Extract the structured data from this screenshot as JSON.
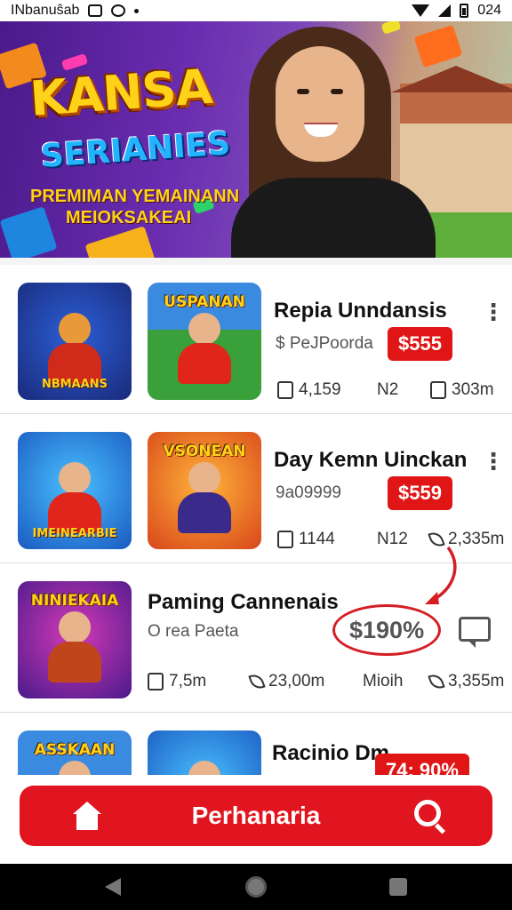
{
  "status_bar": {
    "app_name": "INbanuŝab",
    "time": "024"
  },
  "banner": {
    "title_line1": "KANSA",
    "title_line2": "SERIANIES",
    "subtitle_line1": "PREMIMAN YEMAINANN",
    "subtitle_line2": "MEIOKSAKEAI"
  },
  "items": [
    {
      "title": "Repia Unndansis",
      "meta": "$ PeJPoorda",
      "price": "$555",
      "thumb1": {
        "top": "",
        "bottom": "NBMAANS"
      },
      "thumb2": {
        "top": "USPANAN",
        "bottom": ""
      },
      "stats": [
        "4,159",
        "N2",
        "303m"
      ]
    },
    {
      "title": "Day Kemn Uinckan",
      "meta": "9a09999",
      "price": "$559",
      "thumb1": {
        "top": "",
        "bottom": "IMEINEARBIE"
      },
      "thumb2": {
        "top": "VSONEAN",
        "bottom": ""
      },
      "stats": [
        "1144",
        "N12",
        "2,335m"
      ]
    },
    {
      "title": "Paming Cannenais",
      "meta": "O rea Paeta",
      "price": "$190%",
      "thumb1": {
        "top": "NINIEKAIA",
        "bottom": ""
      },
      "stats": [
        "7,5m",
        "23,00m",
        "Mioih",
        "3,355m"
      ]
    },
    {
      "title": "Racinio Dm",
      "meta": "",
      "price": "74: 90%",
      "thumb1": {
        "top": "ASSKAAN",
        "bottom": ""
      },
      "thumb2": {
        "top": "",
        "bottom": ""
      }
    }
  ],
  "bottom_bar": {
    "label": "Perhanaria"
  },
  "colors": {
    "accent": "#e0151f",
    "price_badge": "#e01515",
    "banner_purple": "#6a2cb0"
  },
  "icons": [
    "home-icon",
    "search-icon",
    "chat-icon",
    "kebab-menu-icon"
  ]
}
